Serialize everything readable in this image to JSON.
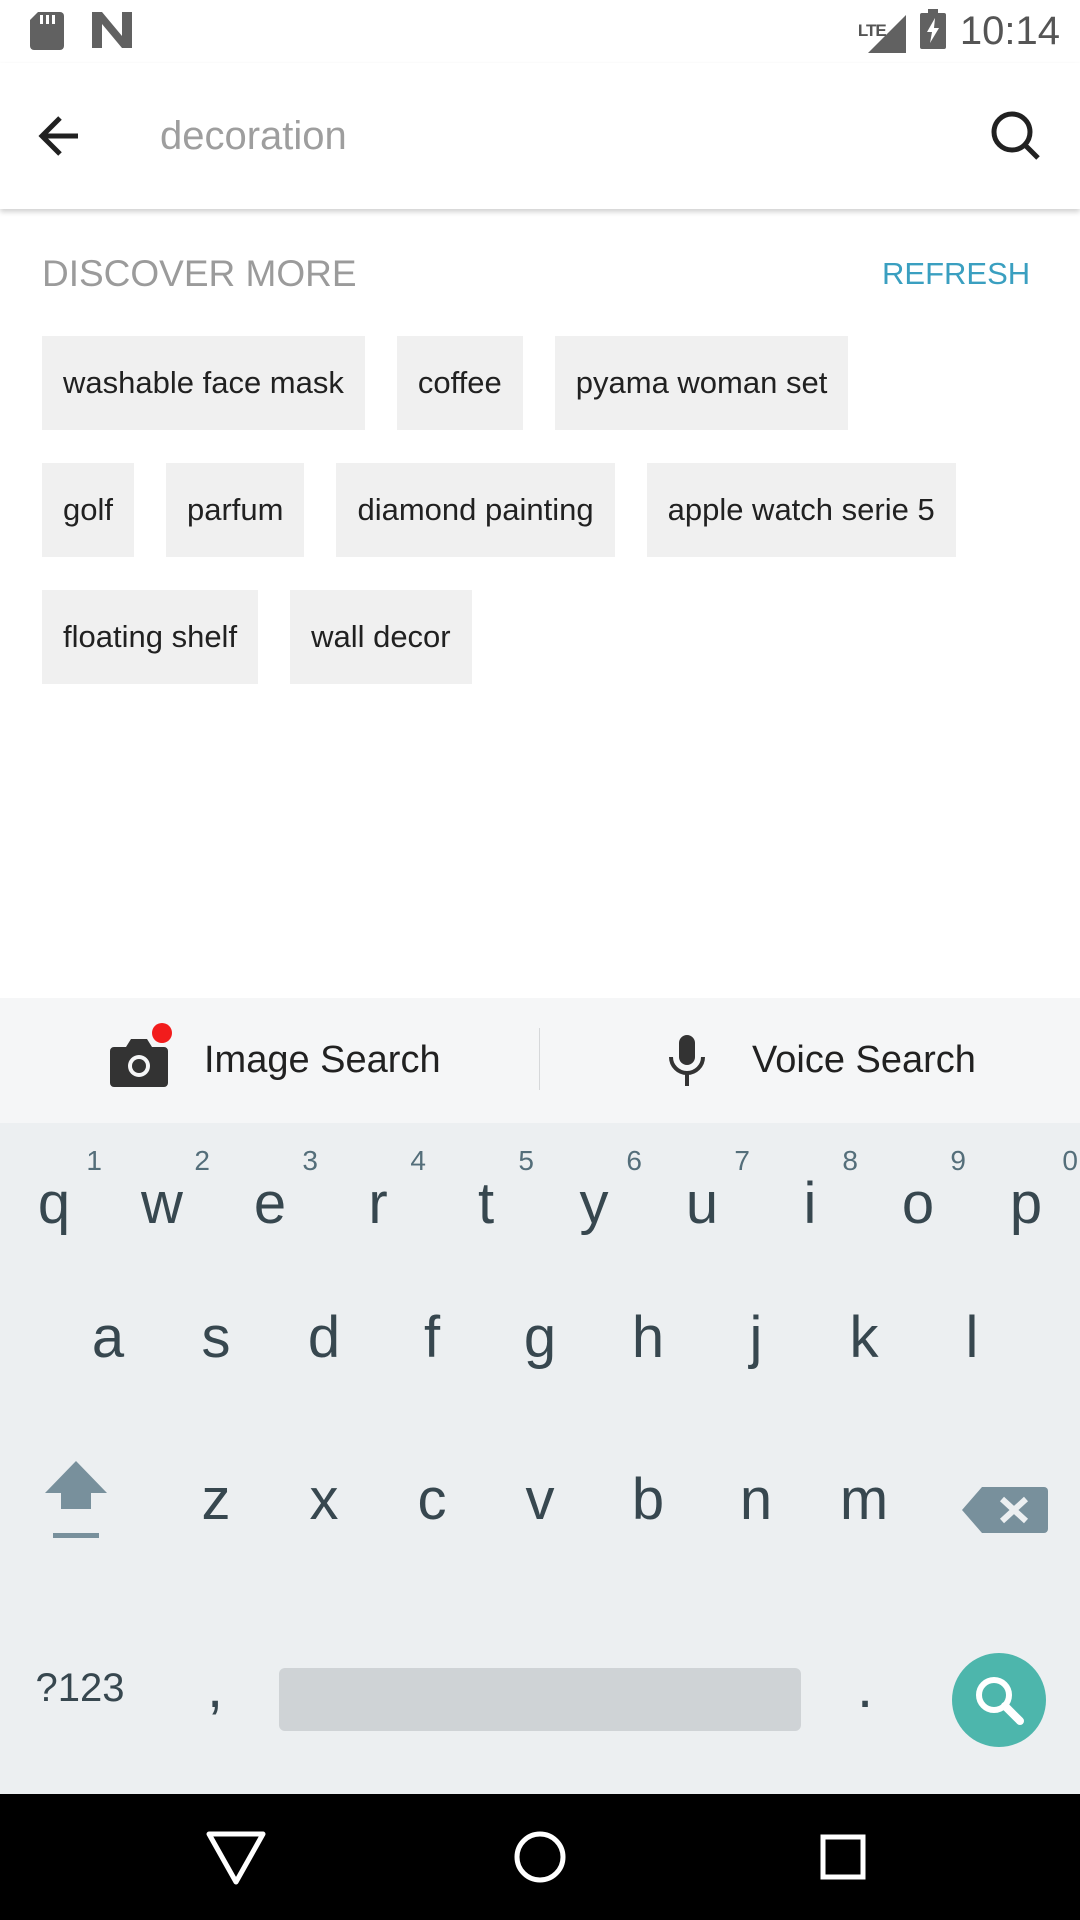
{
  "status_bar": {
    "left_icons": [
      "sd-card-icon",
      "n-logo-icon"
    ],
    "network": "LTE",
    "time": "10:14"
  },
  "search": {
    "placeholder": "decoration",
    "value": ""
  },
  "discover": {
    "title": "DISCOVER MORE",
    "refresh_label": "REFRESH",
    "chip_rows": [
      [
        "washable face mask",
        "coffee",
        "pyama woman set"
      ],
      [
        "golf",
        "parfum",
        "diamond painting",
        "apple watch serie 5"
      ],
      [
        "floating shelf",
        "wall decor"
      ]
    ]
  },
  "keyboard_strip": {
    "image_search_label": "Image Search",
    "voice_search_label": "Voice Search",
    "notification_dot_color": "#f21c1c"
  },
  "keyboard": {
    "row1": [
      "q",
      "w",
      "e",
      "r",
      "t",
      "y",
      "u",
      "i",
      "o",
      "p"
    ],
    "row1_hints": [
      "1",
      "2",
      "3",
      "4",
      "5",
      "6",
      "7",
      "8",
      "9",
      "0"
    ],
    "row2": [
      "a",
      "s",
      "d",
      "f",
      "g",
      "h",
      "j",
      "k",
      "l"
    ],
    "row3": [
      "z",
      "x",
      "c",
      "v",
      "b",
      "n",
      "m"
    ],
    "symbols_label": "?123",
    "comma": ",",
    "period": ".",
    "action_color": "#4db6ac"
  }
}
